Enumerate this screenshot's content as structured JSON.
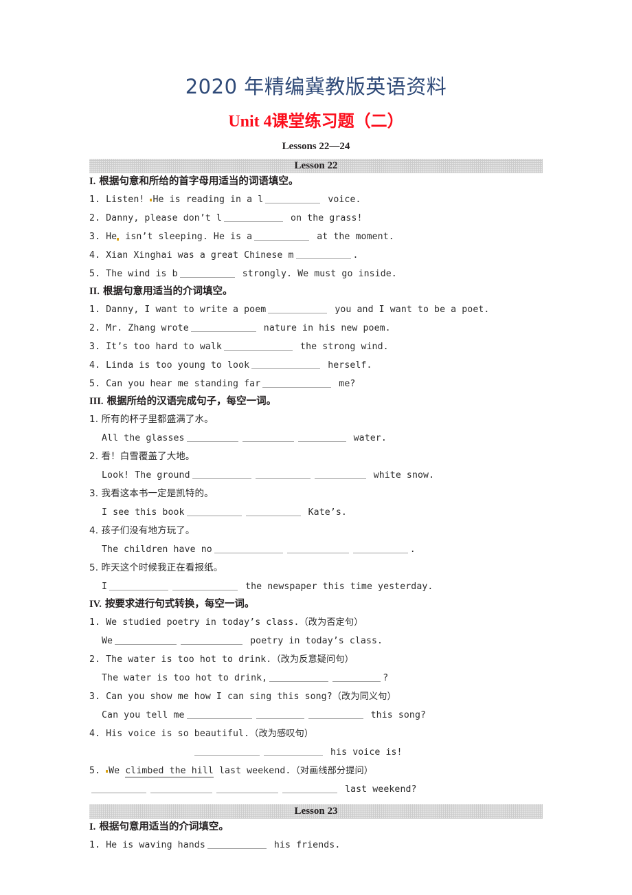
{
  "header": {
    "watermark": "2020 年精编冀教版英语资料",
    "title": "Unit 4课堂练习题（二）",
    "subtitle": "Lessons 22—24",
    "watermark_color": "#2f4a78",
    "title_color": "#fc0d1b",
    "bar_color": "#cccccc"
  },
  "lesson22": {
    "bar_label": "Lesson 22",
    "sections": [
      {
        "roman": "I.",
        "heading": "根据句意和所给的首字母用适当的词语填空。",
        "items": [
          {
            "num": "1.",
            "pre": "Listen! He is reading in a l",
            "post": "voice."
          },
          {
            "num": "2.",
            "pre": "Danny, please don’t l",
            "post": "on the grass!"
          },
          {
            "num": "3.",
            "pre": "He isn’t sleeping. He is a",
            "post": "at the moment."
          },
          {
            "num": "4.",
            "pre": "Xian Xinghai was a great Chinese m",
            "post": "."
          },
          {
            "num": "5.",
            "pre": "The wind is b",
            "post": "strongly. We must go inside."
          }
        ]
      },
      {
        "roman": "II.",
        "heading": "根据句意用适当的介词填空。",
        "items": [
          {
            "num": "1.",
            "pre": "Danny, I want to write a poem",
            "post": "you and I want to be a poet."
          },
          {
            "num": "2.",
            "pre": "Mr. Zhang wrote",
            "post": "nature in his new poem."
          },
          {
            "num": "3.",
            "pre": "It’s too hard to walk",
            "post": "the strong wind."
          },
          {
            "num": "4.",
            "pre": "Linda is too young to look",
            "post": "herself."
          },
          {
            "num": "5.",
            "pre": "Can you hear me standing far",
            "post": "me?"
          }
        ]
      },
      {
        "roman": "III.",
        "heading": "根据所给的汉语完成句子，每空一词。",
        "items": [
          {
            "num": "1.",
            "cn": "所有的杯子里都盛满了水。",
            "pre": "All the glasses",
            "post": "water."
          },
          {
            "num": "2.",
            "cn": "看！白雪覆盖了大地。",
            "pre": "Look! The ground",
            "post": "white snow."
          },
          {
            "num": "3.",
            "cn": "我看这本书一定是凯特的。",
            "pre": "I see this book",
            "post": "Kate’s."
          },
          {
            "num": "4.",
            "cn": "孩子们没有地方玩了。",
            "pre": "The children have no",
            "post": "."
          },
          {
            "num": "5.",
            "cn": "昨天这个时候我正在看报纸。",
            "pre": "I",
            "post": "the newspaper this time yesterday."
          }
        ]
      },
      {
        "roman": "IV.",
        "heading": "按要求进行句式转换，每空一词。",
        "items": [
          {
            "num": "1.",
            "prompt": "We studied poetry in today’s class.（改为否定句）",
            "pre": "We",
            "post": "poetry in today’s class."
          },
          {
            "num": "2.",
            "prompt": "The water is too hot to drink.（改为反意疑问句）",
            "pre": "The water is too hot to drink,",
            "post": "?"
          },
          {
            "num": "3.",
            "prompt": "Can you show me how I can sing this song?（改为同义句）",
            "pre": "Can you tell me",
            "post": "this song?"
          },
          {
            "num": "4.",
            "prompt": "His voice is so beautiful.（改为感叹句）",
            "pre": "",
            "post": "his voice is!"
          },
          {
            "num": "5.",
            "prompt_pre": "We ",
            "prompt_underlined": "climbed the hill",
            "prompt_post": " last weekend.（对画线部分提问）",
            "pre": "",
            "post": "last weekend?"
          }
        ]
      }
    ]
  },
  "lesson23": {
    "bar_label": "Lesson 23",
    "sections": [
      {
        "roman": "I.",
        "heading": "根据句意用适当的介词填空。",
        "items": [
          {
            "num": "1.",
            "pre": "He is waving hands",
            "post": "his friends."
          }
        ]
      }
    ]
  }
}
